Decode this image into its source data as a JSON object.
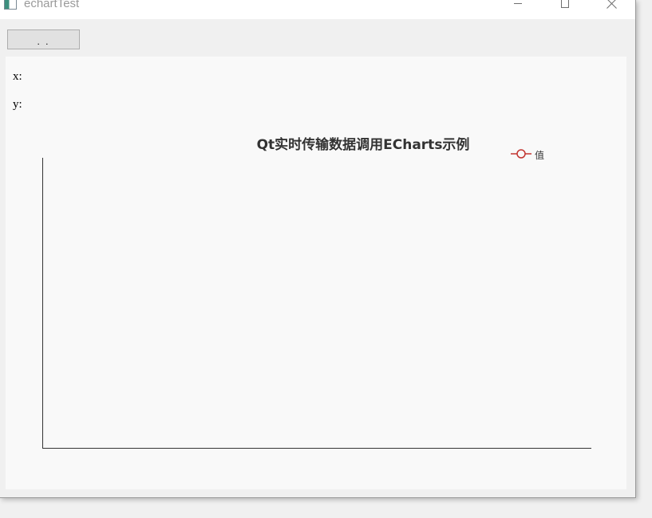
{
  "window": {
    "title": "echartTest",
    "icon": "app-window-icon"
  },
  "toolbar": {
    "button_label": ". ."
  },
  "coords": {
    "x_label": "x:",
    "y_label": "y:"
  },
  "chart_data": {
    "type": "line",
    "title": "Qt实时传输数据调用ECharts示例",
    "series": [
      {
        "name": "值",
        "values": [],
        "color": "#c23531"
      }
    ],
    "x": [],
    "xlabel": "",
    "ylabel": "",
    "grid": false,
    "legend": "top-right"
  }
}
